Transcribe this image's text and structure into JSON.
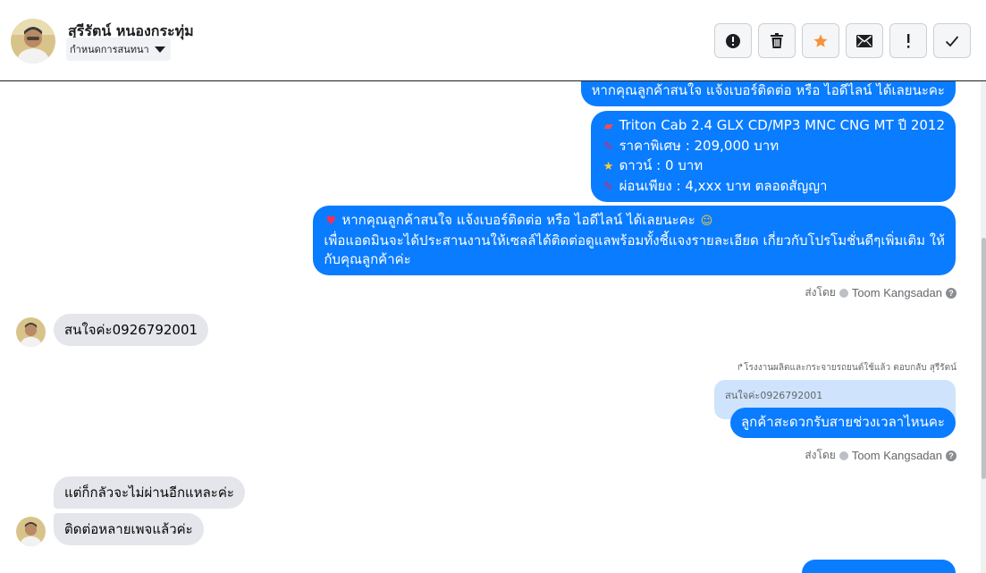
{
  "header": {
    "contact_name": "สุรีรัตน์ หนองกระทุ่ม",
    "assign_label": "กำหนดการสนทนา",
    "actions": [
      {
        "name": "report-button",
        "icon": "alert-circle-icon"
      },
      {
        "name": "delete-button",
        "icon": "trash-icon"
      },
      {
        "name": "star-button",
        "icon": "star-icon"
      },
      {
        "name": "mark-unread-button",
        "icon": "envelope-icon"
      },
      {
        "name": "spam-button",
        "icon": "exclamation-icon"
      },
      {
        "name": "done-button",
        "icon": "checkmark-icon"
      }
    ]
  },
  "messages": {
    "m1": "หากคุณลูกค้าสนใจ แจ้งเบอร์ติดต่อ หรือ ไอดีไลน์ ได้เลยนะคะ",
    "m2": {
      "l1": "Triton Cab 2.4 GLX CD/MP3 MNC  CNG MT ปี 2012",
      "l2": "ราคาพิเศษ : 209,000 บาท",
      "l3": "ดาวน์ : 0 บาท",
      "l4": "ผ่อนเพียง : 4,xxx บาท ตลอดสัญญา"
    },
    "m3": {
      "l1": "หากคุณลูกค้าสนใจ แจ้งเบอร์ติดต่อ หรือ ไอดีไลน์ ได้เลยนะคะ",
      "l2": "เพื่อแอดมินจะได้ประสานงานให้เซลล์ได้ติดต่อดูแลพร้อมทั้งชี้แจงรายละเอียด เกี่ยวกับโปรโมชั่นดีๆเพิ่มเติม ให้",
      "l3": "กับคุณลูกค้าค่ะ"
    },
    "sent_by_label": "ส่งโดย",
    "sent_by_name": "Toom Kangsadan",
    "in1": "สนใจค่ะ0926792001",
    "reply_note": "โรงงานผลิตและกระจายรถยนต์ใช้แล้ว ตอบกลับ สุรีรัตน์",
    "quoted": "สนใจค่ะ0926792001",
    "out_reply": "ลูกค้าสะดวกรับสายช่วงเวลาไหนคะ",
    "in2": "แต่ก็กลัวจะไม่ผ่านอีกแหละค่ะ",
    "in3": "ติดต่อหลายเพจแล้วค่ะ"
  },
  "colors": {
    "outgoing_bubble": "#0a7cff",
    "incoming_bubble": "#e4e6eb",
    "star": "#f7923a"
  }
}
